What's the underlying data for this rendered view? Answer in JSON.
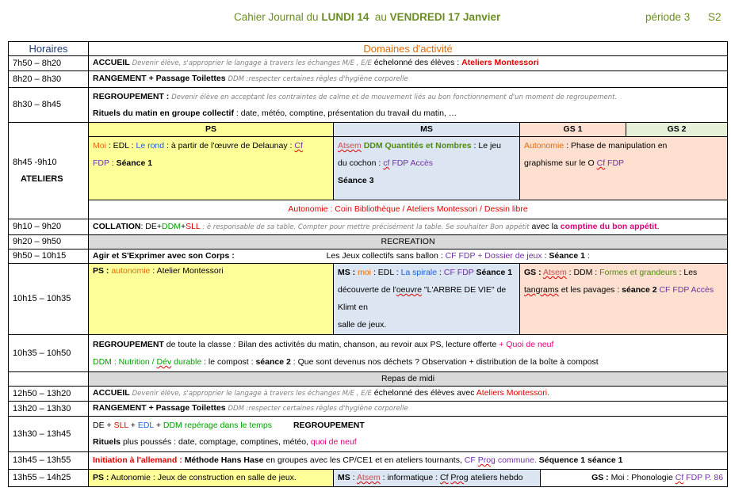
{
  "header": {
    "prefix": "Cahier Journal du",
    "day1": "LUNDI 14",
    "mid": "au",
    "day2": "VENDREDI 17 Janvier",
    "period": "période 3",
    "semester": "S2"
  },
  "table_header": {
    "hours": "Horaires",
    "domains": "Domaines d'activité"
  },
  "rows": {
    "r1": {
      "time": "7h50 – 8h20",
      "a": "ACCUEIL",
      "b": "Devenir élève,  s'approprier le langage à travers les échanges M/E , E/E",
      "c": "échelonné  des élèves :",
      "d": "Ateliers Montessori"
    },
    "r2": {
      "time": "8h20 – 8h30",
      "a": "RANGEMENT + Passage Toilettes",
      "b": "DDM :respecter certaines règles d'hygiène corporelle"
    },
    "r3": {
      "time": "8h30 – 8h45",
      "a": "REGROUPEMENT :",
      "b": "Devenir élève en acceptant les contraintes de calme et de mouvement liés au bon fonctionnement d'un moment de regroupement.",
      "c": "Rituels du matin en groupe collectif",
      "d": ": date, météo, comptine, présentation  du travail du matin, …"
    },
    "r4": {
      "time": "8h45 -9h10",
      "label": "ATELIERS",
      "ps_head": "PS",
      "ms_head": "MS",
      "gs1_head": "GS 1",
      "gs2_head": "GS 2",
      "ps": {
        "a": "Moi",
        "b": ": EDL :",
        "c": "Le rond",
        "d": ": à partir de l'œuvre de Delaunay  :",
        "e": "Cf",
        "f": "FDP",
        "g": ":",
        "h": "Séance 1"
      },
      "ms": {
        "a": "Atsem",
        "b": "DDM Quantités  et Nombres",
        "c": ":  Le jeu",
        "d": "du cochon  :",
        "e": "cf",
        "f": "FDP Accès",
        "g": "Séance 3"
      },
      "gs": {
        "a": "Autonomie",
        "b": ": Phase de manipulation en",
        "c": "graphisme sur le O",
        "d": "Cf",
        "e": "FDP"
      },
      "auto": "Autonomie : Coin Bibliothèque  / Ateliers Montessori / Dessin libre"
    },
    "r5": {
      "time": "9h10 – 9h20",
      "a": "COLLATION",
      "b": ": DE+",
      "c": "DDM",
      "d": "+",
      "e": "SLL",
      "f": ": ê responsable de sa table. Compter pour mettre précisément la table. Se souhaiter Bon appétit",
      "g": "avec la",
      "h": "comptine  du bon appétit",
      "i": "."
    },
    "r6": {
      "time": "9h20 – 9h50",
      "label": "RECREATION"
    },
    "r7": {
      "time": "9h50 – 10h15",
      "a": "Agir et S'Exprimer avec son Corps :",
      "b": "Les Jeux collectifs  sans ballon :",
      "c": "CF FDP + Dossier de jeux",
      "d": ":",
      "e": "Séance 1",
      "f": ":"
    },
    "r8": {
      "time": "10h15 – 10h35",
      "ps": {
        "a": "PS :",
        "b": "autonomie",
        "c": ":  Atelier Montessori"
      },
      "ms": {
        "a": "MS :",
        "b": "moi",
        "c": ": EDL :",
        "d": "La spirale",
        "e": ":",
        "f": "CF FDP",
        "g": "Séance 1",
        "h": "découverte  de l'",
        "i": "oeuvre",
        "j": "\"L'ARBRE DE VIE\" de Klimt en",
        "k": "salle de jeux."
      },
      "gs": {
        "a": "GS :",
        "b": "Atsem",
        "c": ": DDM :",
        "d": "Formes et grandeurs",
        "e": ":  Les",
        "f": "tangrams",
        "g": "et les pavages :",
        "h": "séance 2",
        "i": "CF FDP Accès"
      }
    },
    "r9": {
      "time": "10h35 – 10h50",
      "a": "REGROUPEMENT",
      "b": "de toute  la classe : Bilan des activités du matin, chanson,  au revoir aux PS, lecture offerte",
      "c": "+ Quoi de neuf",
      "d": "DDM : Nutrition /",
      "e": "Dév",
      "f": "durable",
      "g": ": le compost  :",
      "h": "séance 2",
      "i": ": Que sont devenus nos déchets  ? Observation  + distribution de la boîte à compost"
    },
    "r10": {
      "label": "Repas de midi"
    },
    "r11": {
      "time": "12h50 – 13h20",
      "a": "ACCUEIL",
      "b": "Devenir élève,  s'approprier le langage à travers les échanges M/E , E/E",
      "c": "échelonné  des élèves avec",
      "d": "Ateliers Montessori."
    },
    "r12": {
      "time": "13h20 – 13h30",
      "a": "RANGEMENT + Passage Toilettes",
      "b": "DDM :respecter certaines règles d'hygiène corporelle"
    },
    "r13": {
      "time": "13h30 – 13h45",
      "a": "DE +",
      "b": "SLL",
      "c": "+",
      "d": "EDL",
      "e": "+",
      "f": "DDM repérage  dans le temps",
      "g": "REGROUPEMENT",
      "h": "Rituels",
      "i": "plus poussés  : date, comptage, comptines, météo,",
      "j": "quoi de neuf"
    },
    "r14": {
      "time": "13h45 – 13h55",
      "a": "Initiation à l'allemand :",
      "b": "Méthode Hans Hase",
      "c": "en groupes avec les CP/CE1 et en ateliers tournants,",
      "d": "CF",
      "e": "Prog",
      "f": "commune.",
      "g": "Séquence  1 séance 1"
    },
    "r15": {
      "time": "13h55 – 14h25",
      "ps": {
        "a": "PS :",
        "b": "Autonomie  : Jeux de construction  en salle de jeux."
      },
      "ms": {
        "a": "MS",
        "b": ":",
        "c": "Atsem",
        "d": ": informatique :",
        "e": "Cf",
        "f": "Prog",
        "g": "ateliers hebdo"
      },
      "gs": {
        "a": "GS :",
        "b": "Moi : Phonologie",
        "c": "Cf",
        "d": "FDP P. 86"
      }
    }
  }
}
